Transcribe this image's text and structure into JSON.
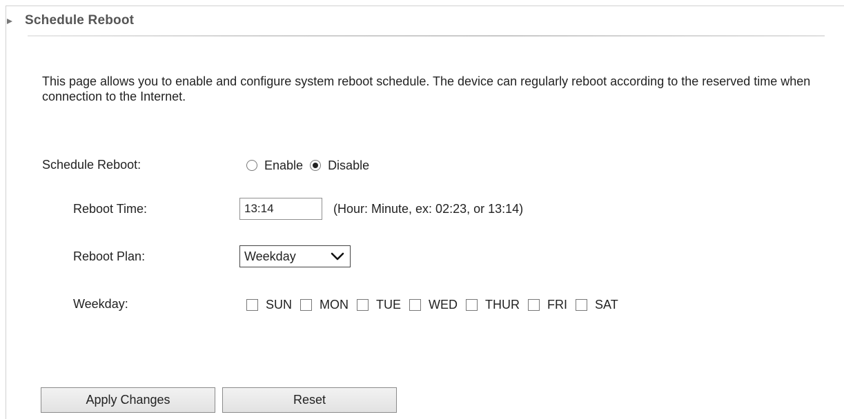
{
  "header": {
    "title": "Schedule Reboot"
  },
  "description": "This page allows you to enable and configure system reboot schedule. The device can regularly reboot according to the reserved time when connection to the Internet.",
  "schedule": {
    "label": "Schedule Reboot:",
    "options": [
      {
        "label": "Enable",
        "checked": false
      },
      {
        "label": "Disable",
        "checked": true
      }
    ]
  },
  "reboot_time": {
    "label": "Reboot Time:",
    "value": "13:14",
    "hint": "(Hour: Minute, ex: 02:23, or 13:14)"
  },
  "reboot_plan": {
    "label": "Reboot Plan:",
    "selected": "Weekday"
  },
  "weekday": {
    "label": "Weekday:",
    "days": [
      {
        "label": "SUN",
        "checked": false
      },
      {
        "label": "MON",
        "checked": false
      },
      {
        "label": "TUE",
        "checked": false
      },
      {
        "label": "WED",
        "checked": false
      },
      {
        "label": "THUR",
        "checked": false
      },
      {
        "label": "FRI",
        "checked": false
      },
      {
        "label": "SAT",
        "checked": false
      }
    ]
  },
  "buttons": {
    "apply": "Apply Changes",
    "reset": "Reset"
  }
}
